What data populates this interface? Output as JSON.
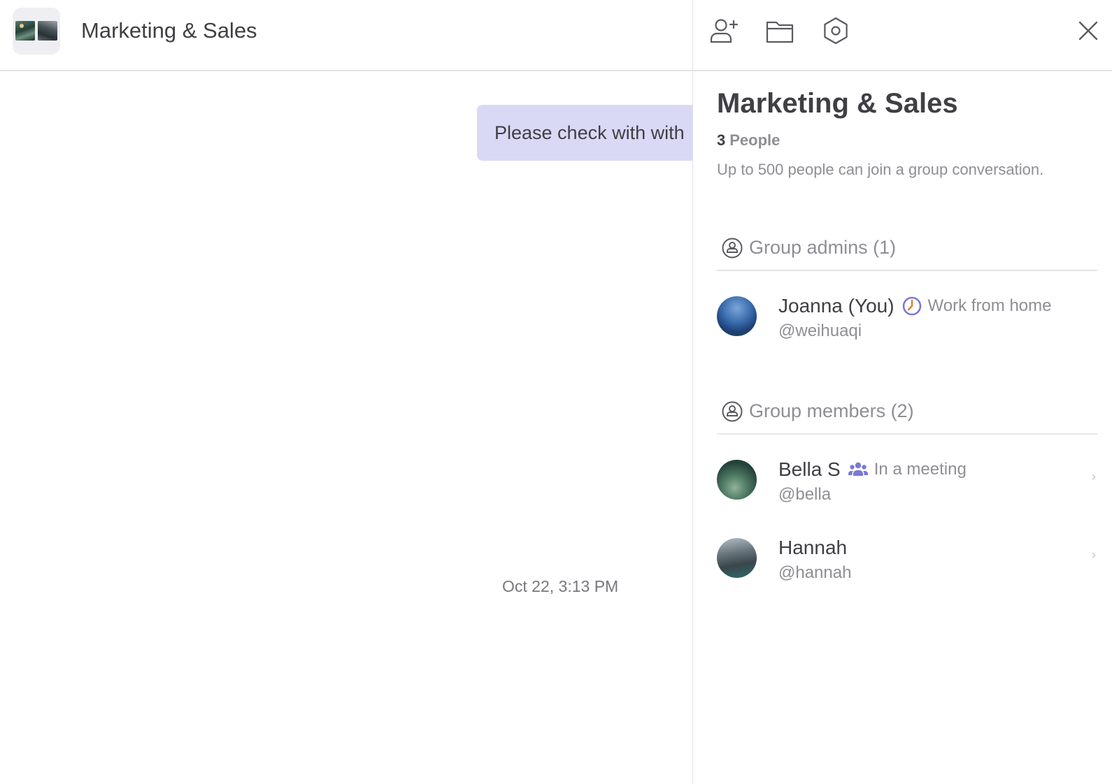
{
  "chat": {
    "title": "Marketing & Sales",
    "message": "Please check with with",
    "timestamp": "Oct 22, 3:13 PM"
  },
  "toolbar": {
    "icons": [
      "add-member-icon",
      "folder-icon",
      "settings-icon",
      "close-icon"
    ]
  },
  "panel": {
    "title": "Marketing & Sales",
    "people_count": "3",
    "people_label": "People",
    "info": "Up to 500 people can join a group conversation.",
    "admins": {
      "title": "Group admins (1)",
      "items": [
        {
          "name": "Joanna (You)",
          "status_icon": "clock-icon",
          "status": "Work from home",
          "handle": "@weihuaqi"
        }
      ]
    },
    "members": {
      "title": "Group members (2)",
      "items": [
        {
          "name": "Bella S",
          "status_icon": "meeting-icon",
          "status": "In a meeting",
          "handle": "@bella",
          "chevron": "›"
        },
        {
          "name": "Hannah",
          "handle": "@hannah",
          "chevron": "›"
        }
      ]
    }
  },
  "colors": {
    "bubble": "#d9d9f6",
    "status_accent": "#7b78d8",
    "muted_text": "#8e8e94",
    "divider": "#e3e3e6"
  }
}
